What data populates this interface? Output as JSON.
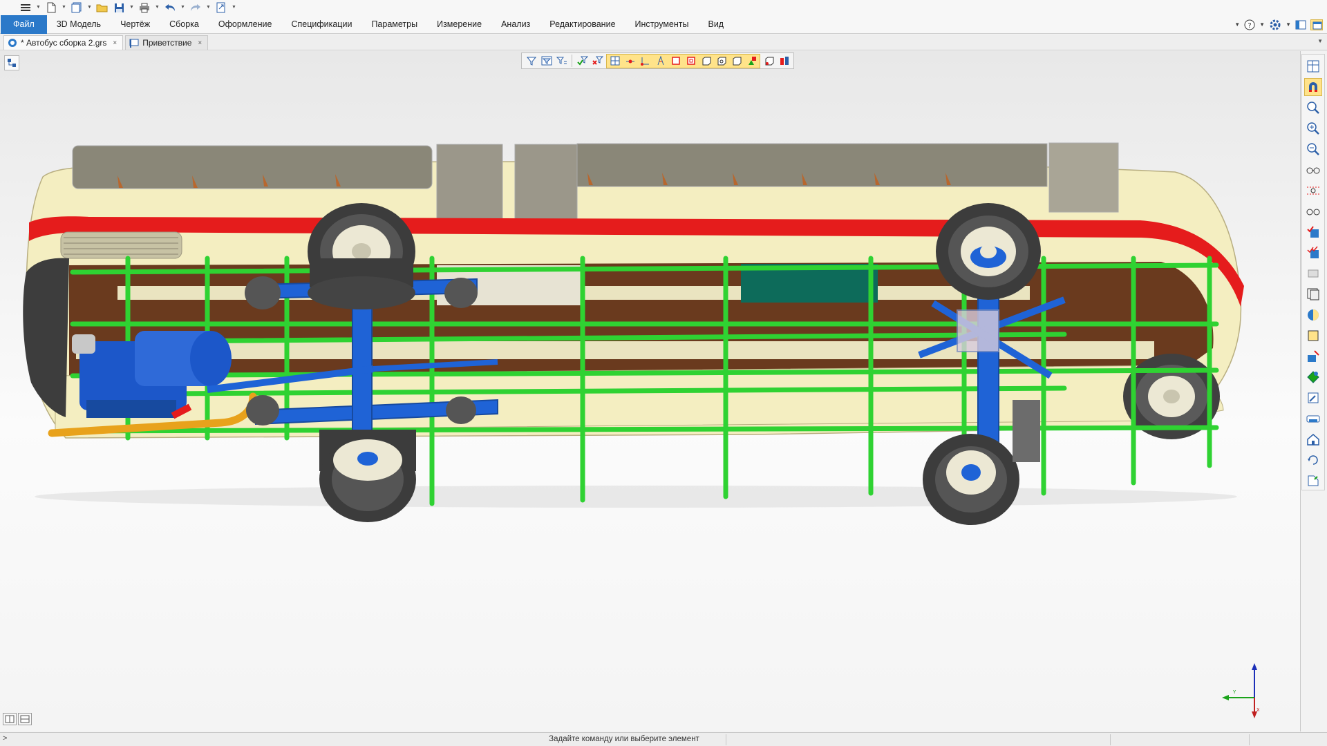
{
  "quick_access": {
    "icons": [
      "menu-icon",
      "new-document-icon",
      "new-from-template-icon",
      "open-folder-icon",
      "save-icon",
      "print-icon",
      "undo-icon",
      "redo-icon",
      "export-icon"
    ]
  },
  "menu": {
    "items": [
      {
        "label": "Файл",
        "active": true
      },
      {
        "label": "3D Модель"
      },
      {
        "label": "Чертёж"
      },
      {
        "label": "Сборка"
      },
      {
        "label": "Оформление"
      },
      {
        "label": "Спецификации"
      },
      {
        "label": "Параметры"
      },
      {
        "label": "Измерение"
      },
      {
        "label": "Анализ"
      },
      {
        "label": "Редактирование"
      },
      {
        "label": "Инструменты"
      },
      {
        "label": "Вид"
      }
    ],
    "right_icons": [
      "help-icon",
      "settings-icon",
      "window-layout-icon",
      "panel-icon"
    ]
  },
  "tabs": [
    {
      "label": "* Автобус сборка 2.grs",
      "icon": "assembly-document-icon",
      "close": "×",
      "active": true
    },
    {
      "label": "Приветствие",
      "icon": "welcome-flag-icon",
      "close": "×",
      "active": false
    }
  ],
  "filter_toolbar": {
    "icons": [
      "filter-icon",
      "filter-settings-icon",
      "filter-list-icon",
      "filter-enable-icon",
      "filter-disable-icon",
      "select-body-icon",
      "select-vertex-icon",
      "select-edge-icon",
      "select-face-icon",
      "select-solid-icon",
      "select-shell-icon",
      "select-loop-icon",
      "select-profile-icon",
      "select-construction-icon",
      "select-group-icon",
      "select-element-icon",
      "select-3d-icon"
    ]
  },
  "right_toolbar": {
    "icons": [
      "view-cube-icon",
      "magnet-snap-icon",
      "zoom-window-icon",
      "zoom-in-icon",
      "zoom-out-icon",
      "show-hidden-icon",
      "visibility-icon",
      "hide-icon",
      "show-body-icon",
      "show-all-bodies-icon",
      "transparency-icon",
      "section-icon",
      "shading-icon",
      "material-icon",
      "color-icon",
      "appearance-icon",
      "measure-tool-icon",
      "camera-icon",
      "home-view-icon",
      "rotate-view-icon",
      "save-view-icon"
    ]
  },
  "status_bar": {
    "prompt": ">",
    "message": "Задайте команду или выберите элемент"
  },
  "colors": {
    "accent": "#2b79c9",
    "bus_body": "#f4eec1",
    "stripe": "#e51c1c",
    "frame": "#2fd232",
    "suspension": "#1f63d6",
    "engine": "#1c57c9",
    "exhaust": "#e8a21c",
    "interior": "#6a3a1e",
    "tank": "#0d6b5a"
  }
}
